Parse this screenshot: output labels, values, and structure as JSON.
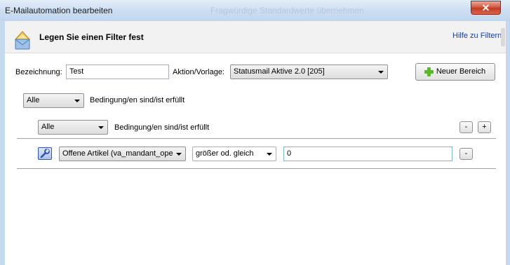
{
  "window": {
    "title": "E-Mailautomation bearbeiten",
    "background_caption": "Fragwürdige Standardwerte übernehmen",
    "close_label": "✕"
  },
  "header": {
    "title": "Legen Sie einen Filter fest",
    "help_link": "Hilfe zu Filtern",
    "icon": "envelope-icon"
  },
  "form": {
    "name_label": "Bezeichnung:",
    "name_value": "Test",
    "action_label": "Aktion/Vorlage:",
    "action_value": "Statusmail Aktive 2.0 [205]",
    "new_area_button": "Neuer Bereich"
  },
  "group_outer": {
    "quantifier": "Alle",
    "text": "Bedingung/en sind/ist erfüllt"
  },
  "group_inner": {
    "quantifier": "Alle",
    "text": "Bedingung/en sind/ist erfüllt",
    "remove_label": "-",
    "add_label": "+"
  },
  "condition": {
    "field": "Offene Artikel (va_mandant_ope",
    "operator": "größer od. gleich",
    "value": "0",
    "remove_label": "-"
  },
  "colors": {
    "close_button": "#c94a33",
    "link": "#1a3d9c",
    "plus_icon": "#5cb82a"
  }
}
